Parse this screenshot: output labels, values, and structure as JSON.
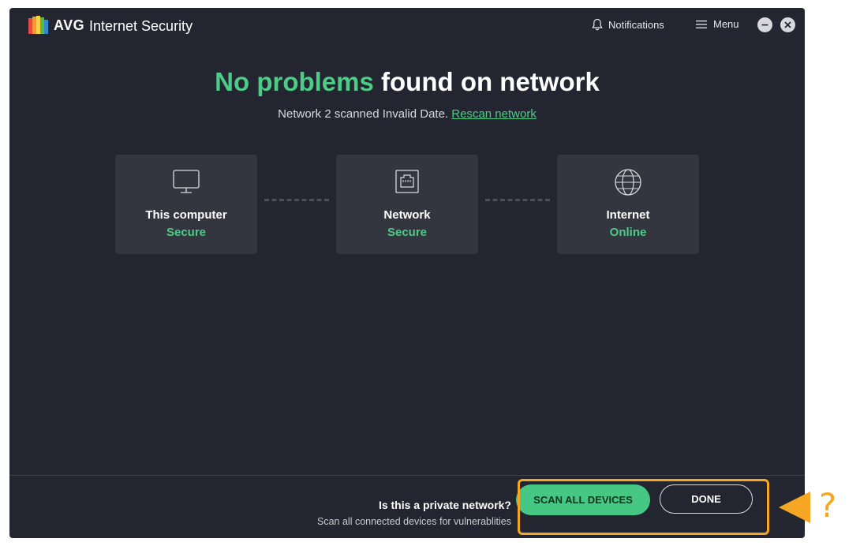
{
  "app": {
    "brand": "AVG",
    "product": "Internet Security",
    "notifications_label": "Notifications",
    "menu_label": "Menu"
  },
  "heading": {
    "highlight": "No problems",
    "rest": " found on network"
  },
  "subline": {
    "text": "Network 2 scanned Invalid Date. ",
    "link": "Rescan network"
  },
  "cards": [
    {
      "title": "This computer",
      "status": "Secure",
      "icon": "monitor-icon"
    },
    {
      "title": "Network",
      "status": "Secure",
      "icon": "ethernet-port-icon"
    },
    {
      "title": "Internet",
      "status": "Online",
      "icon": "globe-icon"
    }
  ],
  "footer": {
    "question": "Is this a private network?",
    "description": "Scan all connected devices for vulnerablities",
    "scan_button": "SCAN ALL DEVICES",
    "done_button": "DONE"
  },
  "annotation": {
    "symbol": "?"
  },
  "colors": {
    "accent_green": "#4ecb87",
    "background": "#232630",
    "card": "#33363f",
    "highlight_orange": "#f5a623"
  }
}
